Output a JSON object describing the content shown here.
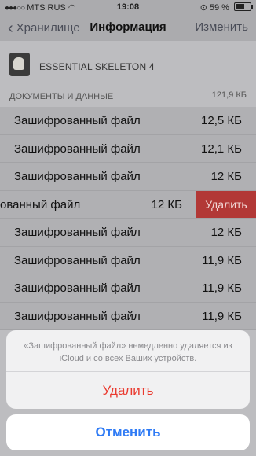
{
  "status": {
    "carrier": "MTS RUS",
    "time": "19:08",
    "battery": "59 %",
    "battery_level": 0.59
  },
  "nav": {
    "back_label": "Хранилище",
    "title": "Информация",
    "edit_label": "Изменить"
  },
  "app": {
    "name": "ESSENTIAL SKELETON 4"
  },
  "section": {
    "label": "ДОКУМЕНТЫ И ДАННЫЕ",
    "total": "121,9 КБ"
  },
  "files": [
    {
      "name": "Зашифрованный файл",
      "size": "12,5 КБ"
    },
    {
      "name": "Зашифрованный файл",
      "size": "12,1 КБ"
    },
    {
      "name": "Зашифрованный файл",
      "size": "12 КБ"
    },
    {
      "name": "ованный файл",
      "size": "12 КБ",
      "swipe_action": "Удалить"
    },
    {
      "name": "Зашифрованный файл",
      "size": "12 КБ"
    },
    {
      "name": "Зашифрованный файл",
      "size": "11,9 КБ"
    },
    {
      "name": "Зашифрованный файл",
      "size": "11,9 КБ"
    },
    {
      "name": "Зашифрованный файл",
      "size": "11,9 КБ"
    }
  ],
  "action_sheet": {
    "message": "«Зашифрованный файл» немедленно удаляется из iCloud и со всех Ваших устройств.",
    "delete_label": "Удалить",
    "cancel_label": "Отменить"
  }
}
